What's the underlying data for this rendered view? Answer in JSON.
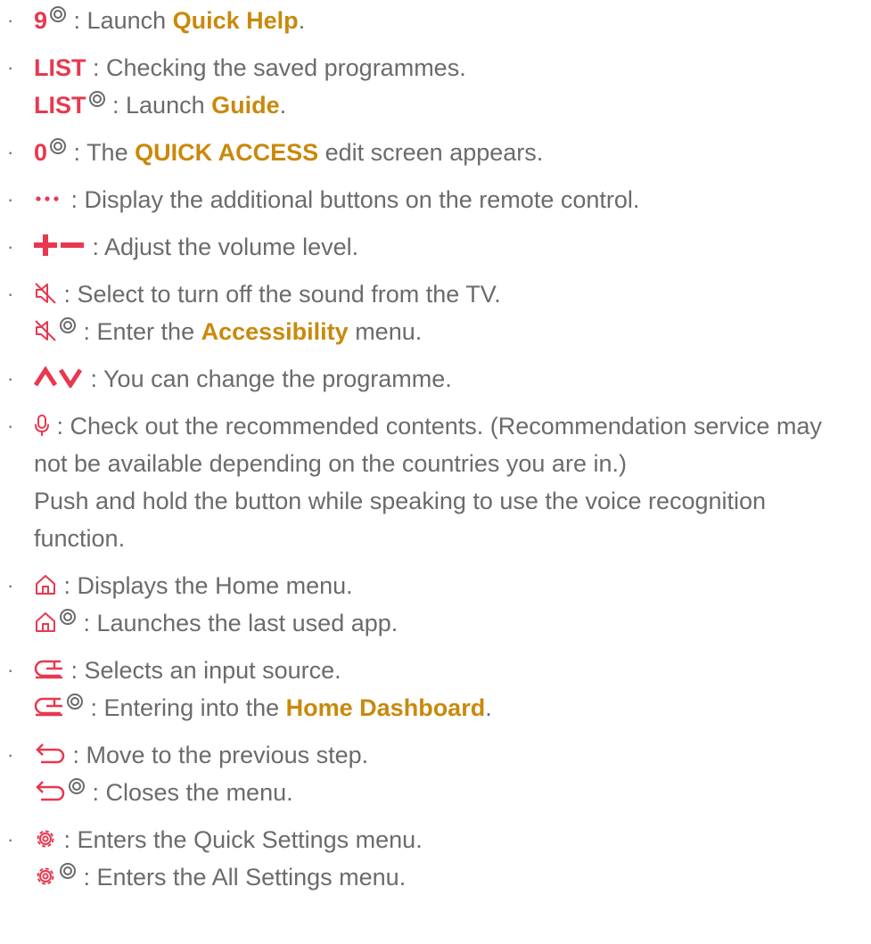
{
  "accent_red": "#e8384f",
  "accent_gold": "#c9890c",
  "text_color": "#6b6b6b",
  "items": [
    {
      "key": "9",
      "sep": " : ",
      "pre": "Launch ",
      "link": "Quick Help",
      "post": "."
    },
    {
      "key": "LIST",
      "line1": " : Checking the saved programmes.",
      "key2": "LIST",
      "sep2": " : ",
      "pre2": "Launch ",
      "link2": "Guide",
      "post2": "."
    },
    {
      "key": "0",
      "sep": " : ",
      "pre": "The ",
      "link": "QUICK ACCESS",
      "post": " edit screen appears."
    },
    {
      "icon": "more-dots-icon",
      "text": " : Display the additional buttons on the remote control."
    },
    {
      "icon": "volume-plus-minus-icon",
      "text": " : Adjust the volume level."
    },
    {
      "icon": "mute-icon",
      "text": " : Select to turn off the sound from the TV.",
      "sep2": " : ",
      "pre2": "Enter the ",
      "link2": "Accessibility",
      "post2": " menu."
    },
    {
      "icon": "channel-up-down-icon",
      "text": " : You can change the programme."
    },
    {
      "icon": "microphone-icon",
      "text": " : Check out the recommended contents. (Recommendation service may not be available depending on the countries you are in.)",
      "text2": "Push and hold the button while speaking to use the voice recognition function."
    },
    {
      "icon": "home-icon",
      "text": " : Displays the Home menu.",
      "text2": " : Launches the last used app."
    },
    {
      "icon": "input-source-icon",
      "text": " : Selects an input source.",
      "sep2": " : ",
      "pre2": "Entering into the ",
      "link2": "Home Dashboard",
      "post2": "."
    },
    {
      "icon": "back-arrow-icon",
      "text": " : Move to the previous step.",
      "text2": " : Closes the menu."
    },
    {
      "icon": "settings-gear-icon",
      "text": " : Enters the Quick Settings menu.",
      "text2": " : Enters the All Settings menu."
    }
  ]
}
